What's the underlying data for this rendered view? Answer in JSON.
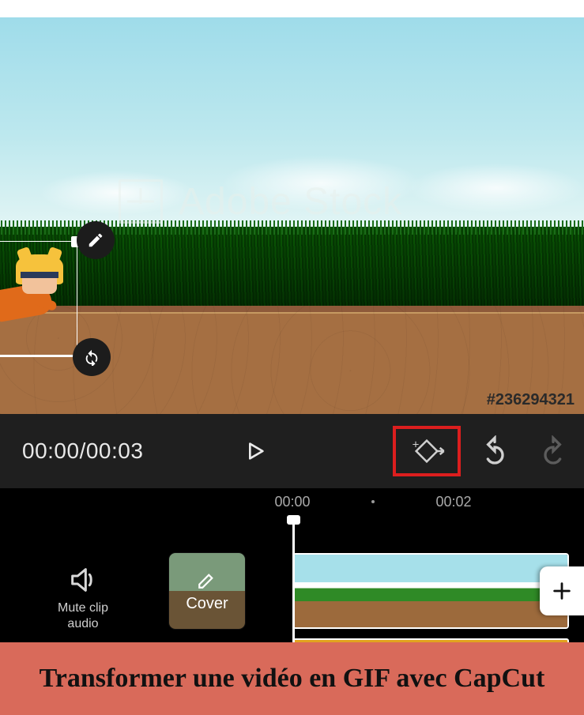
{
  "preview": {
    "watermark_text": "Adobe Stock",
    "stock_id": "#236294321"
  },
  "toolbar": {
    "time_current": "00:00",
    "time_separator": "/",
    "time_total": "00:03"
  },
  "ruler": {
    "label_start": "00:00",
    "label_mid": "00:02"
  },
  "timeline": {
    "mute_label_line1": "Mute clip",
    "mute_label_line2": "audio",
    "cover_label": "Cover"
  },
  "caption": {
    "text": "Transformer une vidéo en GIF avec CapCut"
  },
  "icons": {
    "edit": "edit-icon",
    "rotate": "rotate-icon",
    "play": "play-icon",
    "keyframe": "keyframe-icon",
    "undo": "undo-icon",
    "redo": "redo-icon",
    "speaker": "speaker-icon",
    "pencil": "pencil-icon",
    "plus": "plus-icon"
  }
}
